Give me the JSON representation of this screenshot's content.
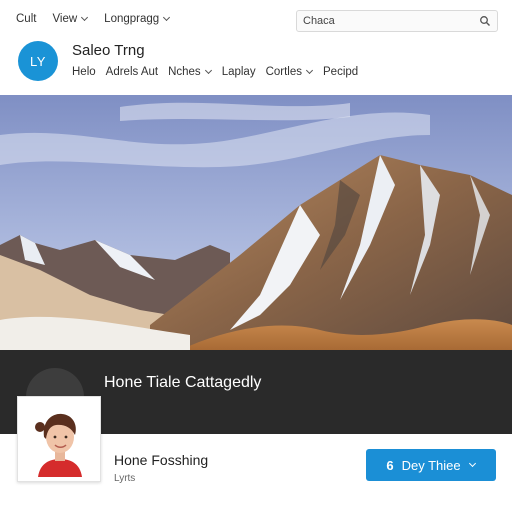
{
  "menubar": {
    "items": [
      {
        "label": "Cult",
        "has_dropdown": false
      },
      {
        "label": "View",
        "has_dropdown": true
      },
      {
        "label": "Longpragg",
        "has_dropdown": true
      }
    ]
  },
  "search": {
    "value": "Chaca",
    "icon": "search-icon"
  },
  "profile": {
    "avatar_initials": "LY",
    "avatar_color": "#1a93d6",
    "name": "Saleo Trng",
    "nav": [
      {
        "label": "Helo",
        "has_dropdown": false
      },
      {
        "label": "Adrels Aut",
        "has_dropdown": false
      },
      {
        "label": "Nches",
        "has_dropdown": true
      },
      {
        "label": "Laplay",
        "has_dropdown": false
      },
      {
        "label": "Cortles",
        "has_dropdown": true
      },
      {
        "label": "Pecipd",
        "has_dropdown": false
      }
    ]
  },
  "band": {
    "title": "Hone Tiale Cattagedly",
    "color": "#2a2a2a"
  },
  "bottom": {
    "title": "Hone Fosshing",
    "subtitle": "Lyrts",
    "cta_number": "6",
    "cta_label": "Dey Thiee",
    "cta_color": "#1b8fd6"
  }
}
